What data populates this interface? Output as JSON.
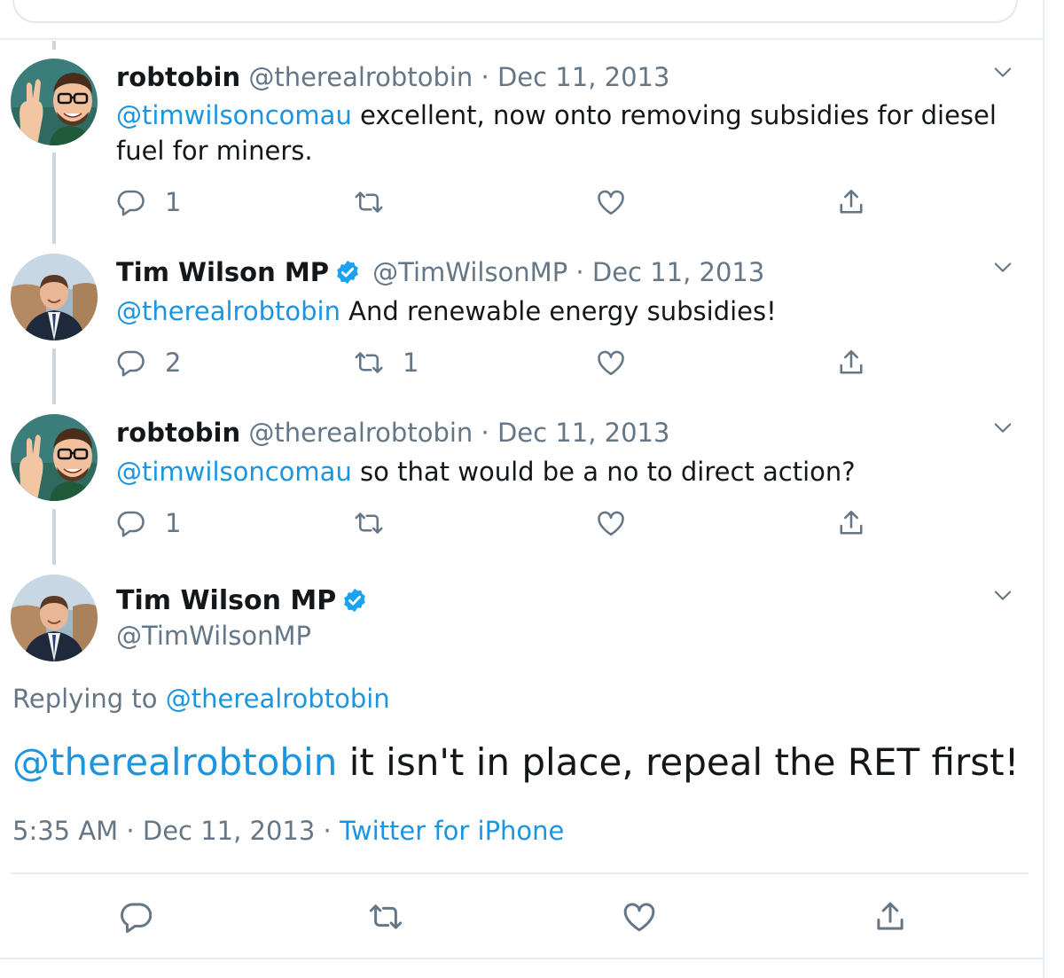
{
  "colors": {
    "accent": "#1b95e0",
    "secondary_text": "#657786",
    "border": "#e6ecf0",
    "thread_line": "#ccd6dd"
  },
  "thread": [
    {
      "name": "robtobin",
      "handle": "@therealrobtobin",
      "date": "Dec 11, 2013",
      "verified": false,
      "mention": "@timwilsoncomau",
      "text": " excellent, now onto removing subsidies for diesel fuel for miners.",
      "reply_count": "1",
      "retweet_count": "",
      "like_count": ""
    },
    {
      "name": "Tim Wilson MP",
      "handle": "@TimWilsonMP",
      "date": "Dec 11, 2013",
      "verified": true,
      "mention": "@therealrobtobin",
      "text": " And renewable energy subsidies!",
      "reply_count": "2",
      "retweet_count": "1",
      "like_count": ""
    },
    {
      "name": "robtobin",
      "handle": "@therealrobtobin",
      "date": "Dec 11, 2013",
      "verified": false,
      "mention": "@timwilsoncomau",
      "text": " so that would be a no to direct action?",
      "reply_count": "1",
      "retweet_count": "",
      "like_count": ""
    }
  ],
  "main_tweet": {
    "name": "Tim Wilson MP",
    "handle": "@TimWilsonMP",
    "verified": true,
    "replying_label": "Replying to ",
    "replying_to": "@therealrobtobin",
    "mention": "@therealrobtobin",
    "text": " it isn't in place, repeal the RET first!",
    "time": "5:35 AM",
    "date": "Dec 11, 2013",
    "separator": " · ",
    "source": "Twitter for iPhone"
  },
  "icons": {
    "reply": "reply-icon",
    "retweet": "retweet-icon",
    "like": "heart-icon",
    "share": "share-icon",
    "more": "chevron-down-icon",
    "verified": "verified-badge-icon"
  }
}
